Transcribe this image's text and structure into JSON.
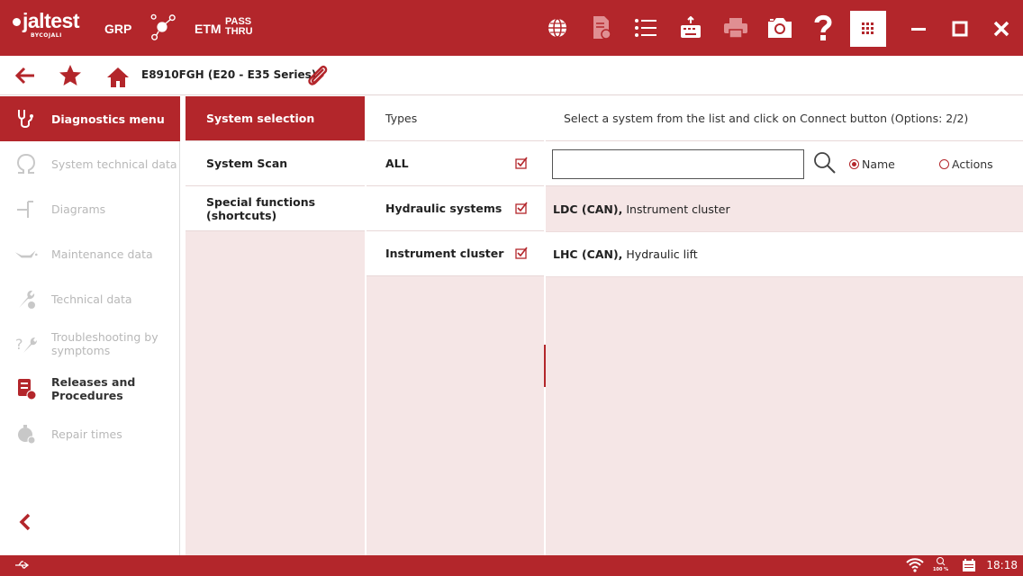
{
  "app": {
    "brand": "jaltest",
    "brand_prefix": "e",
    "brand_sub": "BYCOJALI",
    "grp_label": "GRP",
    "etm_label": "ETM",
    "pass_label_line1": "PASS",
    "pass_label_line2": "THRU"
  },
  "toolbar": {
    "icons": [
      "globe-icon",
      "document-icon",
      "list-icon",
      "keyboard-icon",
      "printer-icon",
      "camera-icon",
      "help-icon"
    ],
    "window_buttons": [
      "apps-grid-icon",
      "minimize-icon",
      "maximize-icon",
      "close-icon"
    ]
  },
  "subbar": {
    "vehicle": "E8910FGH (E20 - E35 Series)"
  },
  "sidebar": {
    "items": [
      {
        "label": "Diagnostics menu",
        "icon": "diagnostics-icon",
        "state": "active"
      },
      {
        "label": "System technical data",
        "icon": "omega-icon",
        "state": "disabled"
      },
      {
        "label": "Diagrams",
        "icon": "diagram-icon",
        "state": "disabled"
      },
      {
        "label": "Maintenance data",
        "icon": "oil-can-icon",
        "state": "disabled"
      },
      {
        "label": "Technical data",
        "icon": "wrench-icon",
        "state": "disabled"
      },
      {
        "label": "Troubleshooting by symptoms",
        "icon": "troubleshooting-icon",
        "state": "disabled"
      },
      {
        "label": "Releases and Procedures",
        "icon": "releases-icon",
        "state": "enabled"
      },
      {
        "label": "Repair times",
        "icon": "stopwatch-icon",
        "state": "disabled"
      }
    ]
  },
  "menu": {
    "items": [
      {
        "label": "System selection",
        "active": true
      },
      {
        "label": "System Scan",
        "active": false
      },
      {
        "label": "Special functions (shortcuts)",
        "active": false
      }
    ]
  },
  "types": {
    "header": "Types",
    "items": [
      {
        "label": "ALL",
        "checked": true
      },
      {
        "label": "Hydraulic systems",
        "checked": true
      },
      {
        "label": "Instrument cluster",
        "checked": true
      }
    ]
  },
  "systems": {
    "header": "Select a system from the list and click on Connect button (Options: 2/2)",
    "search": {
      "value": "",
      "placeholder": ""
    },
    "radio_name": "Name",
    "radio_actions": "Actions",
    "radio_selected": "Name",
    "rows": [
      {
        "code": "LDC (CAN),",
        "desc": " Instrument cluster",
        "selected": true
      },
      {
        "code": "LHC (CAN),",
        "desc": " Hydraulic lift",
        "selected": false
      }
    ]
  },
  "status": {
    "zoom": "100 %",
    "time": "18:18"
  },
  "colors": {
    "brand_red": "#b3262b",
    "panel_pink": "#f5e6e6"
  }
}
